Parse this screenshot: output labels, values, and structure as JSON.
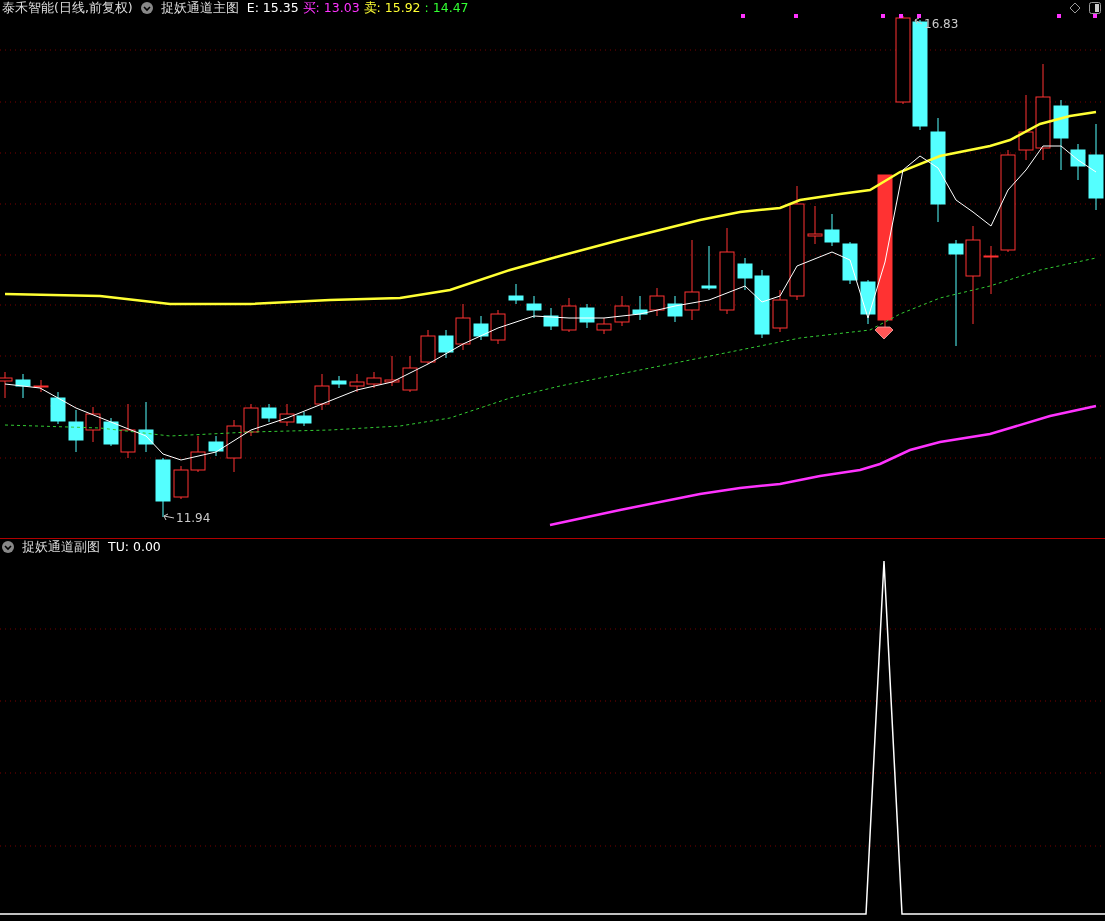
{
  "main_panel": {
    "stock_title": "泰禾智能(日线,前复权)",
    "indicator_name": "捉妖通道主图",
    "readouts": [
      {
        "text": "E: 15.35",
        "color": "#ffffff"
      },
      {
        "text": "买: 13.03",
        "color": "#ff33ff"
      },
      {
        "text": "卖: 15.92",
        "color": "#ffff33"
      },
      {
        "text": ": 14.47",
        "color": "#33ff33"
      }
    ],
    "high_label": "16.83",
    "low_label": "11.94"
  },
  "sub_panel": {
    "indicator_name": "捉妖通道副图",
    "readouts": [
      {
        "text": "TU: 0.00",
        "color": "#ffffff"
      }
    ]
  }
}
